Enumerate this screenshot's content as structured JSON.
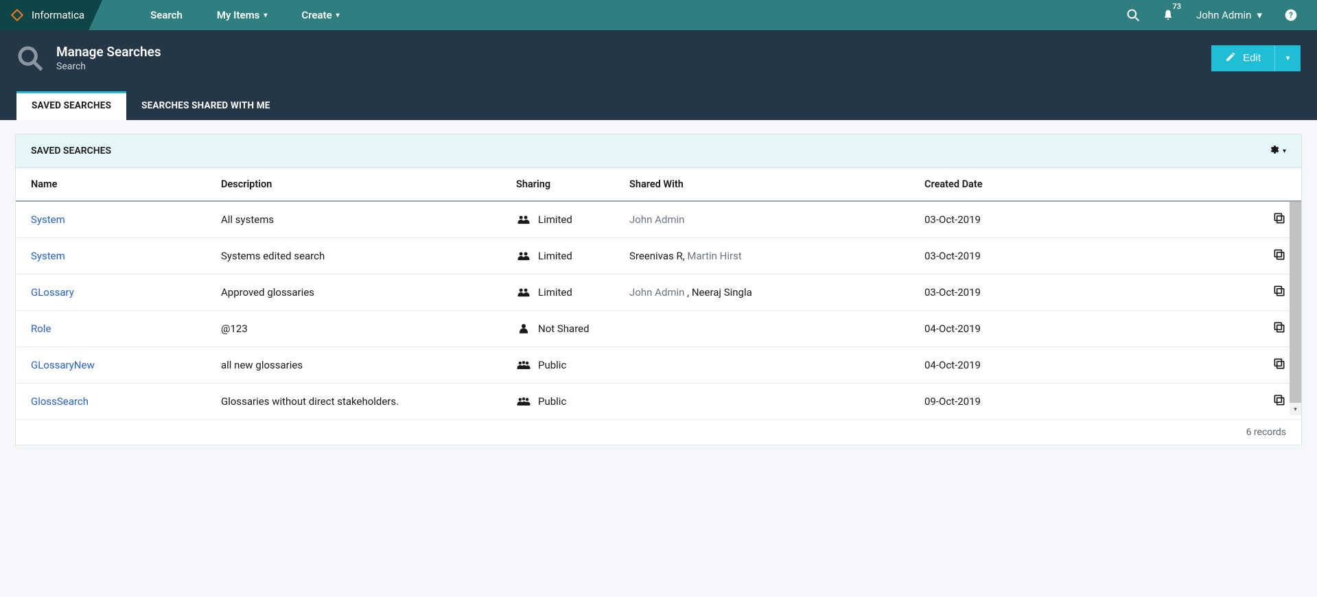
{
  "brand": {
    "name": "Informatica"
  },
  "nav": {
    "links": [
      "Search",
      "My Items",
      "Create"
    ]
  },
  "topRight": {
    "notifications": "73",
    "username": "John Admin"
  },
  "page": {
    "title": "Manage Searches",
    "subtitle": "Search"
  },
  "actions": {
    "editLabel": "Edit"
  },
  "tabs": {
    "savedSearches": "SAVED SEARCHES",
    "sharedWithMe": "SEARCHES SHARED WITH ME"
  },
  "panel": {
    "title": "SAVED SEARCHES"
  },
  "columns": {
    "name": "Name",
    "description": "Description",
    "sharing": "Sharing",
    "sharedWith": "Shared With",
    "createdDate": "Created Date"
  },
  "rows": [
    {
      "name": "System",
      "description": "All systems",
      "sharing": "Limited",
      "sharingIcon": "group",
      "sharedWith": [
        {
          "name": "John Admin",
          "muted": true
        }
      ],
      "created": "03-Oct-2019"
    },
    {
      "name": "System",
      "description": "Systems edited search",
      "sharing": "Limited",
      "sharingIcon": "group",
      "sharedWith": [
        {
          "name": "Sreenivas R,",
          "muted": false
        },
        {
          "name": "Martin Hirst",
          "muted": true
        }
      ],
      "created": "03-Oct-2019"
    },
    {
      "name": "GLossary",
      "description": "Approved glossaries",
      "sharing": "Limited",
      "sharingIcon": "group",
      "sharedWith": [
        {
          "name": "John Admin",
          "muted": true
        },
        {
          "name": ", Neeraj Singla",
          "muted": false
        }
      ],
      "created": "03-Oct-2019"
    },
    {
      "name": "Role",
      "description": "@123",
      "sharing": "Not Shared",
      "sharingIcon": "single",
      "sharedWith": [],
      "created": "04-Oct-2019"
    },
    {
      "name": "GLossaryNew",
      "description": "all new glossaries",
      "sharing": "Public",
      "sharingIcon": "group3",
      "sharedWith": [],
      "created": "04-Oct-2019"
    },
    {
      "name": "GlossSearch",
      "description": "Glossaries without direct stakeholders.",
      "sharing": "Public",
      "sharingIcon": "group3",
      "sharedWith": [],
      "created": "09-Oct-2019"
    }
  ],
  "footer": {
    "recordsText": "6 records"
  }
}
